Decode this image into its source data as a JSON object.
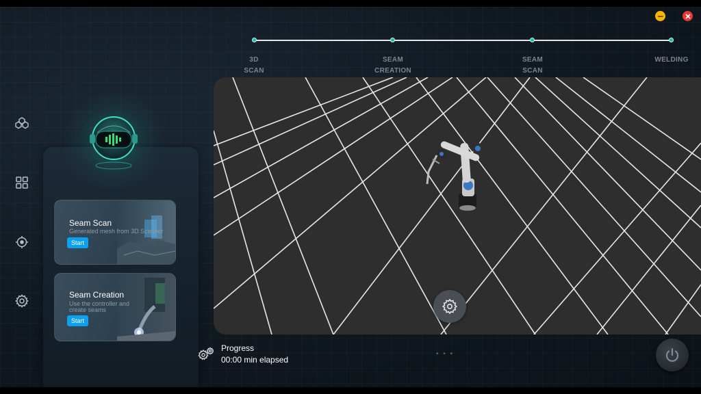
{
  "window": {
    "minimize_icon": "minimize-icon",
    "close_icon": "close-icon"
  },
  "steps": [
    {
      "line1": "3D",
      "line2": "SCAN"
    },
    {
      "line1": "SEAM",
      "line2": "CREATION"
    },
    {
      "line1": "SEAM",
      "line2": "SCAN"
    },
    {
      "line1": "WELDING",
      "line2": ""
    }
  ],
  "sidebar": {
    "icons": [
      "cubes-icon",
      "grid-icon",
      "target-icon",
      "gear-icon"
    ]
  },
  "cards": [
    {
      "title": "Seam Scan",
      "description": "Generated mesh from 3D Scanner",
      "button": "Start"
    },
    {
      "title": "Seam Creation",
      "description": "Use the controller and create seams",
      "button": "Start"
    }
  ],
  "progress": {
    "title": "Progress",
    "elapsed": "00:00 min elapsed"
  },
  "colors": {
    "accent": "#0aa2f0",
    "teal": "#2bb5a8",
    "viewport": "#2e2e2e"
  }
}
